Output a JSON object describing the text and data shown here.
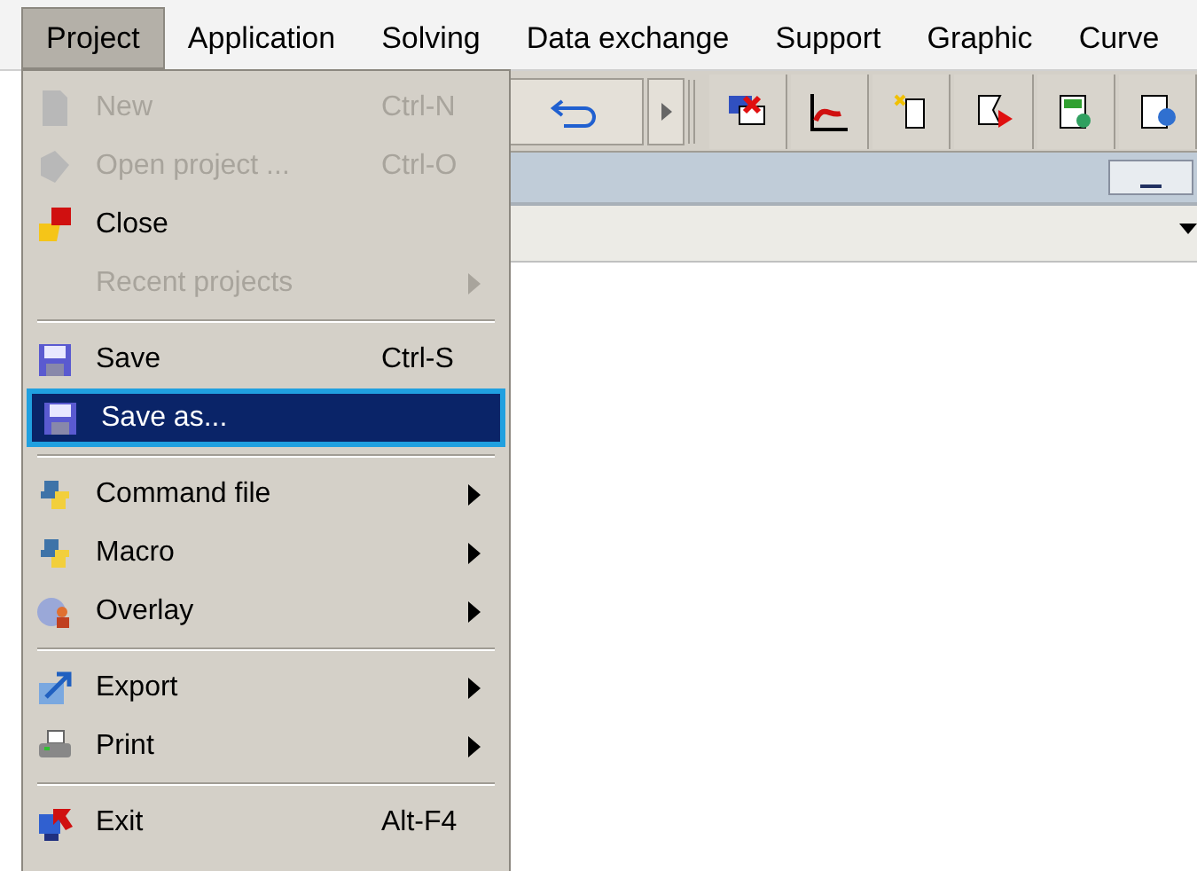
{
  "menu_bar": [
    {
      "label": "Project",
      "selected": true
    },
    {
      "label": "Application",
      "selected": false
    },
    {
      "label": "Solving",
      "selected": false
    },
    {
      "label": "Data exchange",
      "selected": false
    },
    {
      "label": "Support",
      "selected": false
    },
    {
      "label": "Graphic",
      "selected": false
    },
    {
      "label": "Curve",
      "selected": false
    }
  ],
  "project_menu": [
    {
      "kind": "item",
      "label": "New",
      "shortcut": "Ctrl-N",
      "disabled": true,
      "submenu": false,
      "selected": false
    },
    {
      "kind": "item",
      "label": "Open project ...",
      "shortcut": "Ctrl-O",
      "disabled": true,
      "submenu": false,
      "selected": false
    },
    {
      "kind": "item",
      "label": "Close",
      "disabled": false,
      "submenu": false,
      "selected": false
    },
    {
      "kind": "item",
      "label": "Recent projects",
      "disabled": true,
      "submenu": true,
      "selected": false
    },
    {
      "kind": "separator"
    },
    {
      "kind": "item",
      "label": "Save",
      "shortcut": "Ctrl-S",
      "disabled": false,
      "submenu": false,
      "selected": false
    },
    {
      "kind": "item",
      "label": "Save as...",
      "disabled": false,
      "submenu": false,
      "selected": true
    },
    {
      "kind": "separator"
    },
    {
      "kind": "item",
      "label": "Command file",
      "disabled": false,
      "submenu": true,
      "selected": false
    },
    {
      "kind": "item",
      "label": "Macro",
      "disabled": false,
      "submenu": true,
      "selected": false
    },
    {
      "kind": "item",
      "label": "Overlay",
      "disabled": false,
      "submenu": true,
      "selected": false
    },
    {
      "kind": "separator"
    },
    {
      "kind": "item",
      "label": "Export",
      "disabled": false,
      "submenu": true,
      "selected": false
    },
    {
      "kind": "item",
      "label": "Print",
      "disabled": false,
      "submenu": true,
      "selected": false
    },
    {
      "kind": "separator"
    },
    {
      "kind": "item",
      "label": "Exit",
      "shortcut": "Alt-F4",
      "disabled": false,
      "submenu": false,
      "selected": false
    }
  ]
}
